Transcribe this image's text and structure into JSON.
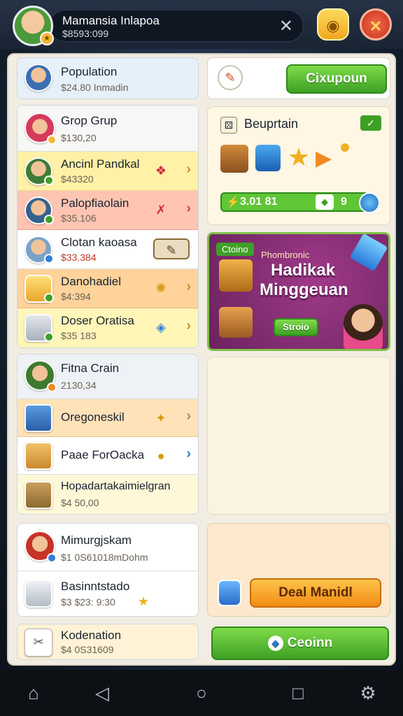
{
  "header": {
    "player_name": "Mamansia Inlapoa",
    "player_balance": "$8593:099",
    "close_symbol": "✕"
  },
  "left": {
    "top_card": {
      "title": "Population",
      "sub": "$24.80 Inmadin"
    },
    "group1": [
      {
        "title": "Grop Grup",
        "sub": "$130,20"
      },
      {
        "title": "Ancinl Pandkal",
        "sub": "$43320"
      },
      {
        "title": "Palopfiaolain",
        "sub": "$35.106"
      },
      {
        "title": "Clotan kaoasa",
        "sub": "$33.384"
      },
      {
        "title": "Danohadiel",
        "sub": "$4:394"
      },
      {
        "title": "Doser Oratisa",
        "sub": "$35 183"
      }
    ],
    "group2": [
      {
        "title": "Fitna Crain",
        "sub": "2130,34"
      },
      {
        "title": "Oregoneskil",
        "sub": ""
      },
      {
        "title": "Paae ForOacka",
        "sub": ""
      },
      {
        "title": "Hopadartakaimielgran",
        "sub": "$4 50,00"
      }
    ],
    "group3": [
      {
        "title": "Mimurgjskam",
        "sub": "$1 0S61018mDohm"
      },
      {
        "title": "Basinntstado",
        "sub": "$3 $23: 9:30"
      }
    ],
    "bottom_card": {
      "title": "Kodenation",
      "sub": "$4 0S31609"
    }
  },
  "right": {
    "top_button": "Cixupoun",
    "bundle": {
      "title": "Beuprtain",
      "price": "3.01 81",
      "count": "9"
    },
    "promo": {
      "tag": "Ctoino",
      "line_small": "Phombronic",
      "line1": "Hadikak",
      "line2": "Minggeuan",
      "button": "Stroio"
    },
    "deal_button": "Deal Manidl",
    "claim_button": "Ceoinn"
  },
  "nav": {
    "home": "⌂",
    "back": "◁",
    "circle": "○",
    "square": "□",
    "gear": "⚙"
  },
  "colors": {
    "accent_green": "#3ea024",
    "accent_orange": "#f18c14",
    "promo_bg": "#7a2a6e",
    "row_yellow": "#fff3b0",
    "row_red": "#ffc9b8",
    "row_orange": "#ffd6a3"
  }
}
